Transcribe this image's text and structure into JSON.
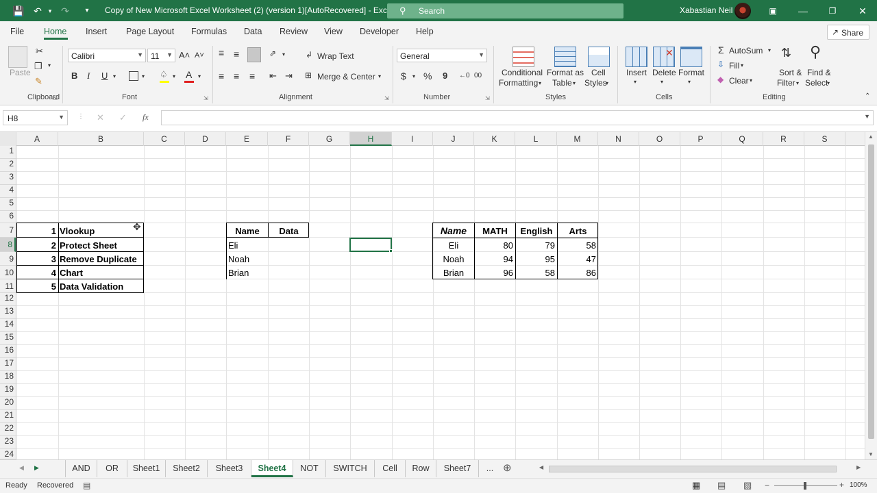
{
  "titlebar": {
    "title": "Copy of New Microsoft Excel Worksheet (2) (version 1)[AutoRecovered]  -  Excel",
    "search_label": "Search",
    "user_name": "Xabastian Neil"
  },
  "menu": {
    "tabs": [
      "File",
      "Home",
      "Insert",
      "Page Layout",
      "Formulas",
      "Data",
      "Review",
      "View",
      "Developer",
      "Help"
    ],
    "active": "Home",
    "share_label": "Share"
  },
  "ribbon": {
    "clipboard": {
      "paste": "Paste",
      "label": "Clipboard"
    },
    "font": {
      "name": "Calibri",
      "size": "11",
      "label": "Font",
      "bold": "B",
      "italic": "I",
      "underline": "U"
    },
    "alignment": {
      "wrap_text": "Wrap Text",
      "merge_center": "Merge & Center",
      "label": "Alignment"
    },
    "number": {
      "format": "General",
      "label": "Number",
      "currency": "$",
      "percent": "%",
      "comma": "9"
    },
    "styles": {
      "conditional_1": "Conditional",
      "conditional_2": "Formatting",
      "format_table_1": "Format as",
      "format_table_2": "Table",
      "cell_styles_1": "Cell",
      "cell_styles_2": "Styles",
      "label": "Styles"
    },
    "cells": {
      "insert": "Insert",
      "delete": "Delete",
      "format": "Format",
      "label": "Cells"
    },
    "editing": {
      "autosum": "AutoSum",
      "fill": "Fill",
      "clear": "Clear",
      "sort_1": "Sort &",
      "sort_2": "Filter",
      "find_1": "Find &",
      "find_2": "Select",
      "label": "Editing"
    }
  },
  "formula_bar": {
    "name_box": "H8",
    "fx": "fx",
    "formula": ""
  },
  "columns": [
    "A",
    "B",
    "C",
    "D",
    "E",
    "F",
    "G",
    "H",
    "I",
    "J",
    "K",
    "L",
    "M",
    "N",
    "O",
    "P",
    "Q",
    "R",
    "S"
  ],
  "selected_column": "H",
  "rows": [
    "1",
    "2",
    "3",
    "4",
    "5",
    "6",
    "7",
    "8",
    "9",
    "10",
    "11",
    "12",
    "13",
    "14",
    "15",
    "16",
    "17",
    "18",
    "19",
    "20",
    "21",
    "22",
    "23",
    "24"
  ],
  "selected_row": "8",
  "list_table": {
    "numbers": [
      "1",
      "2",
      "3",
      "4",
      "5"
    ],
    "items": [
      "Vlookup",
      "Protect Sheet",
      "Remove Duplicate",
      "Chart",
      "Data Validation"
    ]
  },
  "lookup_table": {
    "headers": [
      "Name",
      "Data"
    ],
    "names": [
      "Eli",
      "Noah",
      "Brian"
    ]
  },
  "scores_table": {
    "headers": [
      "Name",
      "MATH",
      "English",
      "Arts"
    ],
    "rows": [
      {
        "name": "Eli",
        "math": "80",
        "english": "79",
        "arts": "58"
      },
      {
        "name": "Noah",
        "math": "94",
        "english": "95",
        "arts": "47"
      },
      {
        "name": "Brian",
        "math": "96",
        "english": "58",
        "arts": "86"
      }
    ]
  },
  "sheet_tabs": [
    "AND",
    "OR",
    "Sheet1",
    "Sheet2",
    "Sheet3",
    "Sheet4",
    "NOT",
    "SWITCH",
    "Cell",
    "Row",
    "Sheet7",
    "..."
  ],
  "active_sheet": "Sheet4",
  "status": {
    "ready": "Ready",
    "recovered": "Recovered",
    "zoom": "100%"
  },
  "colors": {
    "accent": "#217346",
    "search_bg": "#6eb28b"
  }
}
